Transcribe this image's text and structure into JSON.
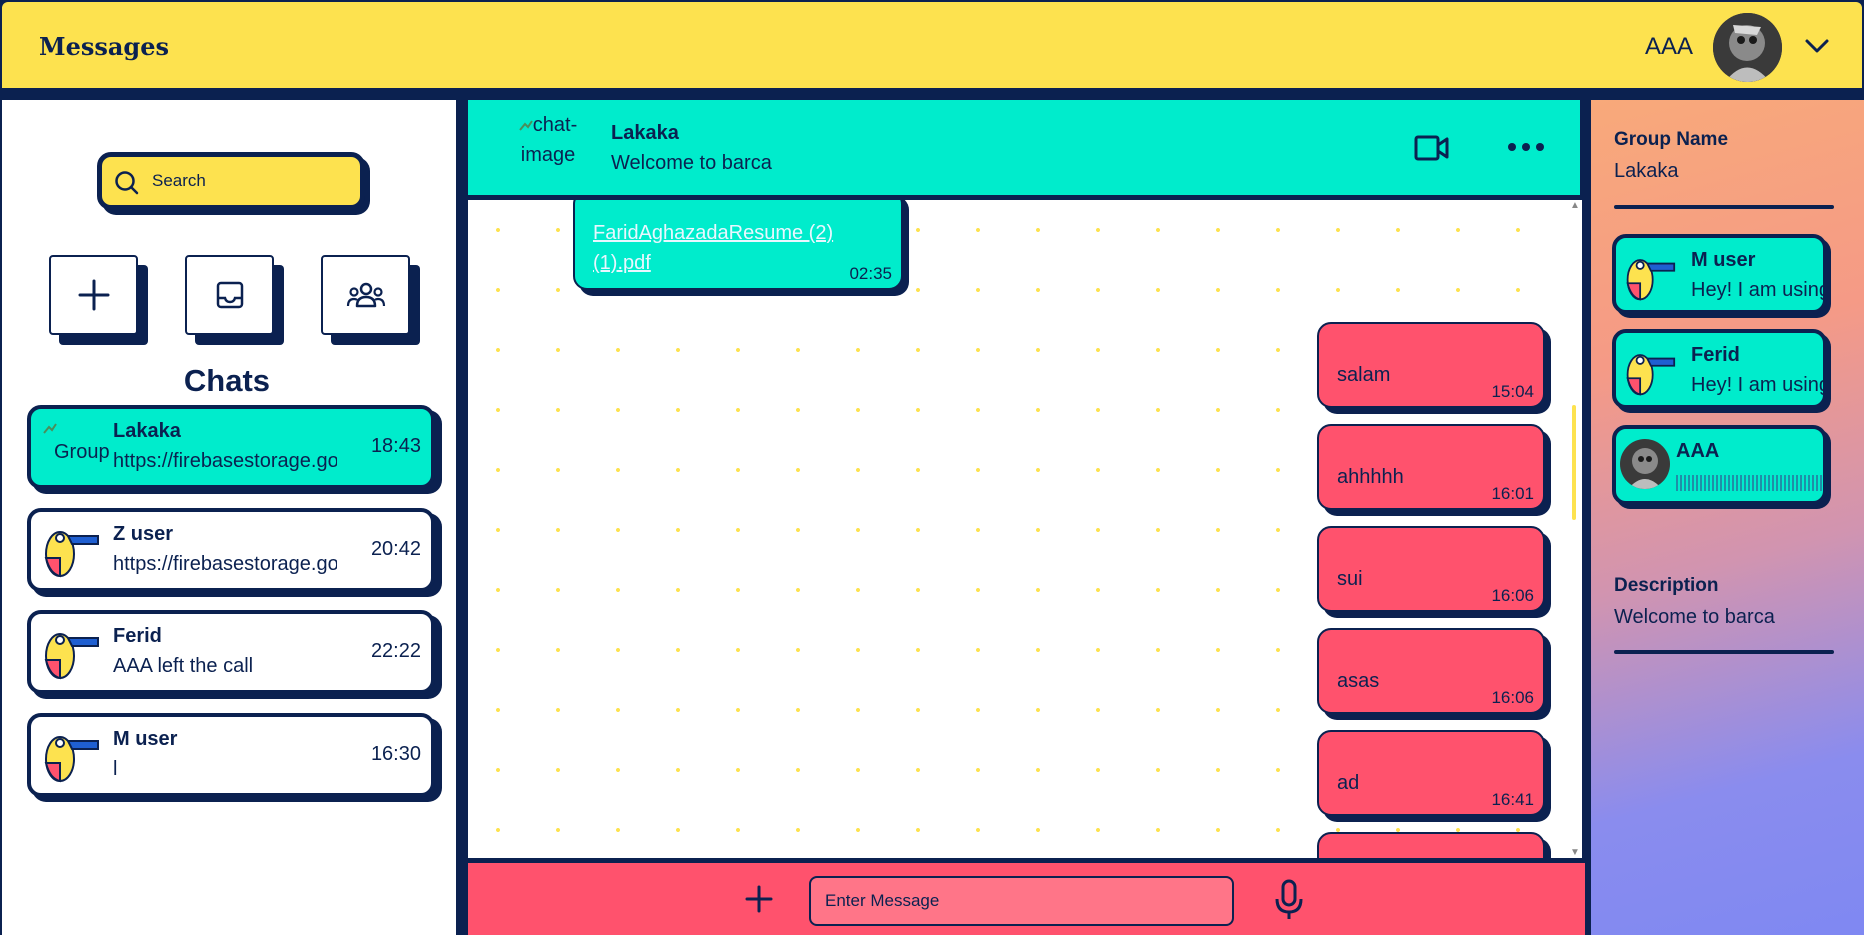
{
  "header": {
    "title": "Messages",
    "user_name": "AAA"
  },
  "sidebar": {
    "search_placeholder": "Search",
    "chats_title": "Chats",
    "chats": [
      {
        "name": "Lakaka",
        "preview": "https://firebasestorage.googleapis.com",
        "time": "18:43",
        "avatar_alt": "Group",
        "active": true
      },
      {
        "name": "Z user",
        "preview": "https://firebasestorage.googleapis.com",
        "time": "20:42",
        "active": false
      },
      {
        "name": "Ferid",
        "preview": "AAA left the call",
        "time": "22:22",
        "active": false
      },
      {
        "name": "M user",
        "preview": "l",
        "time": "16:30",
        "active": false
      }
    ]
  },
  "room": {
    "image_alt": "chat-image",
    "name": "Lakaka",
    "description": "Welcome to barca"
  },
  "messages": [
    {
      "type": "file",
      "text": "FaridAghazadaResume (2) (1).pdf",
      "time": "02:35",
      "own": false
    },
    {
      "type": "text",
      "text": "salam",
      "time": "15:04",
      "own": true
    },
    {
      "type": "text",
      "text": "ahhhhh",
      "time": "16:01",
      "own": true
    },
    {
      "type": "text",
      "text": "sui",
      "time": "16:06",
      "own": true
    },
    {
      "type": "text",
      "text": "asas",
      "time": "16:06",
      "own": true
    },
    {
      "type": "text",
      "text": "ad",
      "time": "16:41",
      "own": true
    }
  ],
  "composer": {
    "placeholder": "Enter Message"
  },
  "details": {
    "group_name_label": "Group Name",
    "group_name": "Lakaka",
    "members": [
      {
        "name": "M user",
        "status": "Hey! I am using"
      },
      {
        "name": "Ferid",
        "status": "Hey! I am using"
      },
      {
        "name": "AAA",
        "status": ""
      }
    ],
    "description_label": "Description",
    "description": "Welcome to barca"
  },
  "colors": {
    "yellow": "#fde24f",
    "navy": "#0b2150",
    "teal": "#00eccc",
    "pink": "#ff526d"
  }
}
